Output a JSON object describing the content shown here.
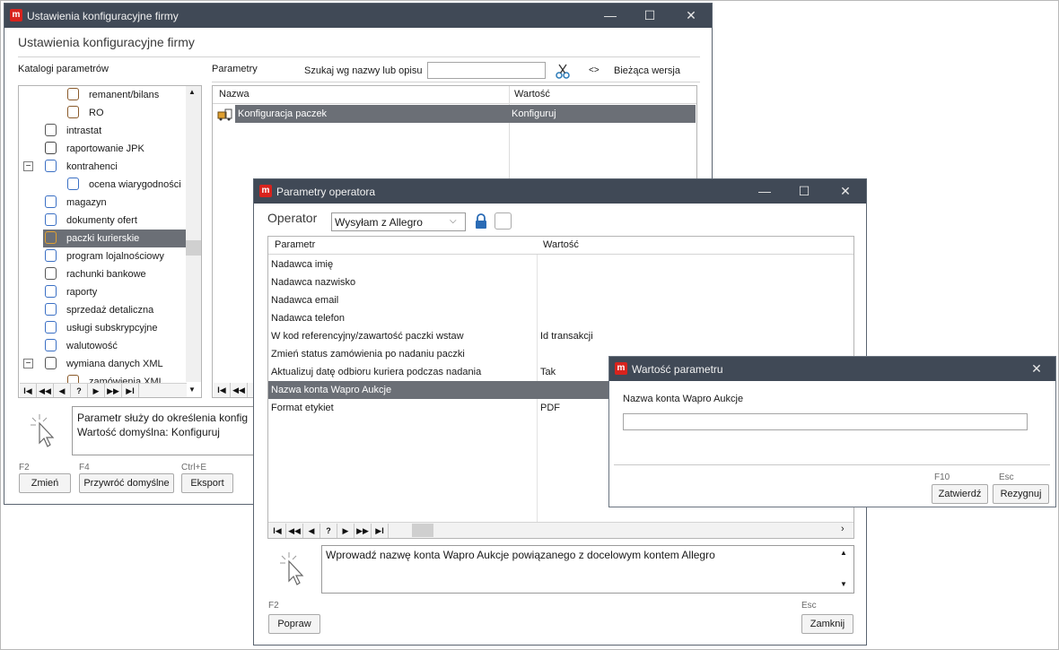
{
  "main_window": {
    "title": "Ustawienia konfiguracyjne firmy",
    "heading": "Ustawienia konfiguracyjne firmy",
    "catalogs_label": "Katalogi parametrów",
    "params_label": "Parametry",
    "search_label": "Szukaj wg nazwy lub opisu",
    "search_value": "",
    "version_toggle": "<>",
    "version_label": "Bieżąca wersja",
    "tree_items": [
      {
        "label": "remanent/bilans",
        "icon": "document-icon"
      },
      {
        "label": "RO",
        "icon": "document-icon"
      },
      {
        "label": "intrastat",
        "icon": "list-document-icon"
      },
      {
        "label": "raportowanie JPK",
        "icon": "users-gear-icon"
      },
      {
        "label": "kontrahenci",
        "icon": "contacts-icon"
      },
      {
        "label": "ocena wiarygodności",
        "icon": "contacts-icon"
      },
      {
        "label": "magazyn",
        "icon": "warehouse-icon"
      },
      {
        "label": "dokumenty ofert",
        "icon": "tag-icon"
      },
      {
        "label": "paczki kurierskie",
        "icon": "courier-icon"
      },
      {
        "label": "program lojalnościowy",
        "icon": "loyalty-icon"
      },
      {
        "label": "rachunki bankowe",
        "icon": "bank-icon"
      },
      {
        "label": "raporty",
        "icon": "network-icon"
      },
      {
        "label": "sprzedaż detaliczna",
        "icon": "cart-icon"
      },
      {
        "label": "usługi subskrypcyjne",
        "icon": "globe-icon"
      },
      {
        "label": "walutowość",
        "icon": "euro-icon"
      },
      {
        "label": "wymiana danych XML",
        "icon": "xml-icon"
      },
      {
        "label": "zamówienia XML",
        "icon": "document-icon"
      }
    ],
    "tree_expand_minus": "−",
    "params_columns": [
      "Nazwa",
      "Wartość"
    ],
    "params_rows": [
      {
        "name": "Konfiguracja paczek",
        "value": "Konfiguruj"
      }
    ],
    "description_line1": "Parametr służy do określenia konfig",
    "description_line2": "Wartość domyślna: Konfiguruj",
    "buttons": [
      {
        "key": "F2",
        "label": "Zmień"
      },
      {
        "key": "F4",
        "label": "Przywróć domyślne"
      },
      {
        "key": "Ctrl+E",
        "label": "Eksport"
      }
    ],
    "nav_glyphs": [
      "I◀",
      "◀◀",
      "◀",
      "?",
      "▶",
      "▶▶",
      "▶I"
    ]
  },
  "operator_window": {
    "title": "Parametry operatora",
    "operator_label": "Operator",
    "operator_value": "Wysyłam z Allegro",
    "columns": [
      "Parametr",
      "Wartość"
    ],
    "rows": [
      {
        "param": "Nadawca imię",
        "value": ""
      },
      {
        "param": "Nadawca nazwisko",
        "value": ""
      },
      {
        "param": "Nadawca email",
        "value": ""
      },
      {
        "param": "Nadawca telefon",
        "value": ""
      },
      {
        "param": "W kod referencyjny/zawartość paczki wstaw",
        "value": "Id transakcji"
      },
      {
        "param": "Zmień status zamówienia po nadaniu paczki",
        "value": ""
      },
      {
        "param": "Aktualizuj datę odbioru kuriera podczas nadania",
        "value": "Tak"
      },
      {
        "param": "Nazwa konta Wapro Aukcje",
        "value": ""
      },
      {
        "param": "Format etykiet",
        "value": "PDF"
      }
    ],
    "selected_row": 7,
    "description": "Wprowadź nazwę konta Wapro Aukcje powiązanego z docelowym kontem Allegro",
    "left_key": "F2",
    "left_button": "Popraw",
    "right_key": "Esc",
    "right_button": "Zamknij"
  },
  "value_dialog": {
    "title": "Wartość parametru",
    "field_label": "Nazwa konta Wapro Aukcje",
    "field_value": "",
    "confirm_key": "F10",
    "confirm_label": "Zatwierdź",
    "cancel_key": "Esc",
    "cancel_label": "Rezygnuj"
  },
  "window_controls": {
    "minimize": "—",
    "maximize": "☐",
    "close": "✕"
  },
  "logo_letter": "m",
  "colors": {
    "titlebar": "#404956",
    "selection": "#6b6f76",
    "brand": "#d8231d"
  }
}
